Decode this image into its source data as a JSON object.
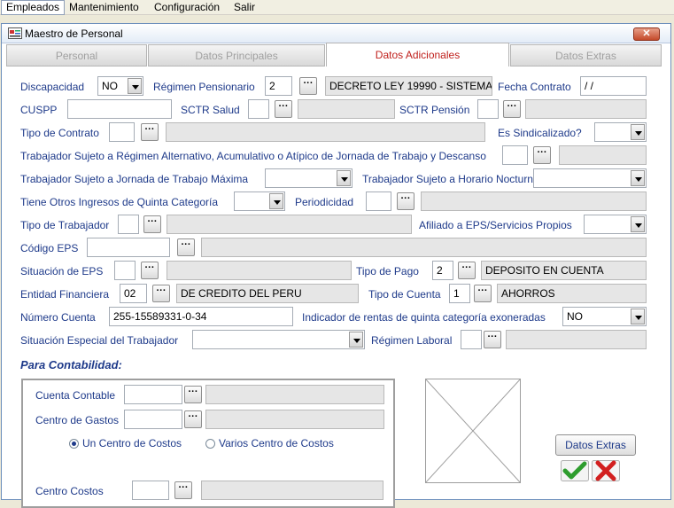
{
  "menu": [
    "Empleados",
    "Mantenimiento",
    "Configuración",
    "Salir"
  ],
  "window": {
    "title": "Maestro de Personal",
    "close_label": "✕"
  },
  "tabs": [
    "Personal",
    "Datos Principales",
    "Datos Adicionales",
    "Datos Extras"
  ],
  "form": {
    "discapacidad": {
      "label": "Discapacidad",
      "value": "NO"
    },
    "regimen_pensionario": {
      "label": "Régimen Pensionario",
      "code": "2",
      "desc": "DECRETO LEY 19990 - SISTEMA"
    },
    "fecha_contrato": {
      "label": "Fecha Contrato",
      "value": " / /"
    },
    "cuspp": {
      "label": "CUSPP",
      "value": ""
    },
    "sctr_salud": {
      "label": "SCTR Salud",
      "code": "",
      "desc": ""
    },
    "sctr_pension": {
      "label": "SCTR Pensión",
      "code": "",
      "desc": ""
    },
    "tipo_contrato": {
      "label": "Tipo de Contrato",
      "code": "",
      "desc": ""
    },
    "es_sindicalizado": {
      "label": "Es Sindicalizado?",
      "value": ""
    },
    "regimen_alternativo": {
      "label": "Trabajador Sujeto a Régimen Alternativo, Acumulativo o Atípico de Jornada de Trabajo y Descanso",
      "code": "",
      "desc": ""
    },
    "jornada_maxima": {
      "label": "Trabajador Sujeto a Jornada de Trabajo Máxima",
      "value": ""
    },
    "horario_nocturno": {
      "label": "Trabajador Sujeto a Horario Nocturno",
      "value": ""
    },
    "otros_ingresos": {
      "label": "Tiene Otros Ingresos de Quinta Categoría",
      "value": ""
    },
    "periodicidad": {
      "label": "Periodicidad",
      "code": "",
      "desc": ""
    },
    "tipo_trabajador": {
      "label": "Tipo de Trabajador",
      "code": "",
      "desc": ""
    },
    "afiliado_eps": {
      "label": "Afiliado a EPS/Servicios Propios",
      "value": ""
    },
    "codigo_eps": {
      "label": "Código EPS",
      "code": "",
      "desc": ""
    },
    "situacion_eps": {
      "label": "Situación de EPS",
      "code": "",
      "desc": ""
    },
    "tipo_pago": {
      "label": "Tipo de Pago",
      "code": "2",
      "desc": "DEPOSITO EN CUENTA"
    },
    "entidad_financiera": {
      "label": "Entidad Financiera",
      "code": "02",
      "desc": "DE CREDITO DEL PERU"
    },
    "tipo_cuenta": {
      "label": "Tipo de Cuenta",
      "code": "1",
      "desc": "AHORROS"
    },
    "numero_cuenta": {
      "label": "Número Cuenta",
      "value": "255-15589331-0-34"
    },
    "rentas_exoneradas": {
      "label": "Indicador de rentas de quinta categoría exoneradas",
      "value": "NO"
    },
    "situacion_especial": {
      "label": "Situación Especial del Trabajador",
      "value": ""
    },
    "regimen_laboral": {
      "label": "Régimen Laboral",
      "code": "",
      "desc": ""
    }
  },
  "contabilidad": {
    "title": "Para Contabilidad:",
    "cuenta_contable": {
      "label": "Cuenta Contable",
      "code": "",
      "desc": ""
    },
    "centro_gastos": {
      "label": "Centro de Gastos",
      "code": "",
      "desc": ""
    },
    "radio_un": "Un Centro de Costos",
    "radio_varios": "Varios Centro de Costos",
    "selected_radio": "un",
    "centro_costos": {
      "label": "Centro Costos",
      "code": "",
      "desc": ""
    }
  },
  "buttons": {
    "dots": "···",
    "datos_extras": "Datos Extras"
  },
  "colors": {
    "label": "#1e3a8a",
    "active_tab": "#c0201c",
    "ok": "#2e9d2e",
    "cancel": "#d21f1f"
  },
  "icons": {
    "ok": "check-icon",
    "cancel": "x-icon",
    "app": "app-icon"
  }
}
